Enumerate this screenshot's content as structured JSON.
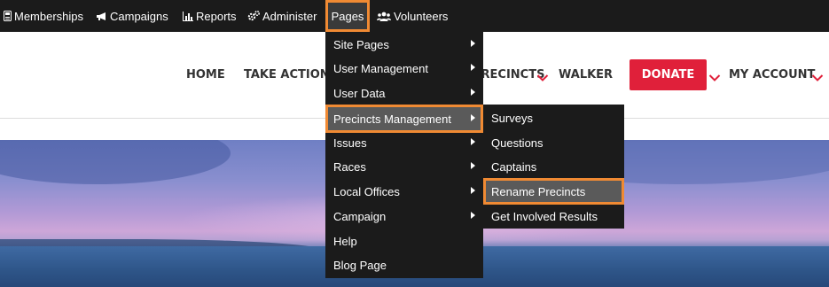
{
  "admin_bar": {
    "items": [
      {
        "label": "Memberships",
        "icon": "id-card-icon"
      },
      {
        "label": "Campaigns",
        "icon": "megaphone-icon"
      },
      {
        "label": "Reports",
        "icon": "chart-icon"
      },
      {
        "label": "Administer",
        "icon": "gears-icon"
      },
      {
        "label": "Pages",
        "icon": ""
      },
      {
        "label": "Volunteers",
        "icon": "users-icon"
      }
    ]
  },
  "site_nav": {
    "items": [
      "HOME",
      "TAKE ACTION",
      "PRECINCTS",
      "WALKER",
      "DONATE",
      "MY ACCOUNT"
    ]
  },
  "pages_menu": {
    "items": [
      {
        "label": "Site Pages",
        "has_submenu": true
      },
      {
        "label": "User Management",
        "has_submenu": true
      },
      {
        "label": "User Data",
        "has_submenu": true
      },
      {
        "label": "Precincts Management",
        "has_submenu": true,
        "highlighted": true
      },
      {
        "label": "Issues",
        "has_submenu": true
      },
      {
        "label": "Races",
        "has_submenu": true
      },
      {
        "label": "Local Offices",
        "has_submenu": true
      },
      {
        "label": "Campaign",
        "has_submenu": true
      },
      {
        "label": "Help",
        "has_submenu": false
      },
      {
        "label": "Blog Page",
        "has_submenu": false
      }
    ]
  },
  "precincts_submenu": {
    "items": [
      {
        "label": "Surveys"
      },
      {
        "label": "Questions"
      },
      {
        "label": "Captains"
      },
      {
        "label": "Rename Precincts",
        "highlighted": true
      },
      {
        "label": "Get Involved Results"
      }
    ]
  },
  "colors": {
    "admin_bar_bg": "#1b1b1b",
    "highlight_outline": "#f08a33",
    "donate_bg": "#e0203a",
    "chevron": "#e0203a"
  }
}
